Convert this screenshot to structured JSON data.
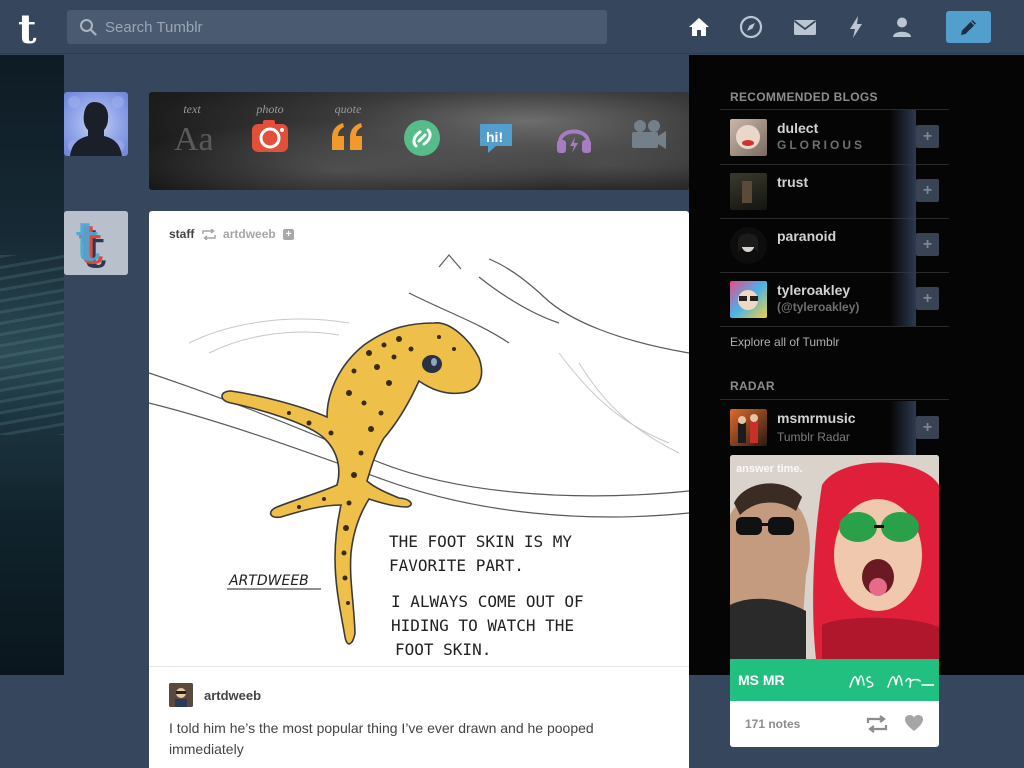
{
  "header": {
    "search_placeholder": "Search Tumblr",
    "nav_icons": [
      "home-icon",
      "explore-compass-icon",
      "inbox-envelope-icon",
      "activity-lightning-icon",
      "account-person-icon"
    ],
    "compose_icon": "pencil-icon",
    "accent": "#529ecc",
    "bg": "#36465d"
  },
  "post_types": [
    {
      "label": "text",
      "icon": "text-aa-icon"
    },
    {
      "label": "photo",
      "icon": "camera-icon",
      "color": "#e2503a"
    },
    {
      "label": "quote",
      "icon": "quote-icon",
      "color": "#f2992e"
    },
    {
      "label": "",
      "icon": "link-icon",
      "color": "#56bc8a"
    },
    {
      "label": "",
      "icon": "chat-hi-icon",
      "color": "#529ecc",
      "text": "hi!"
    },
    {
      "label": "",
      "icon": "audio-headphones-icon",
      "color": "#a77dc2"
    },
    {
      "label": "",
      "icon": "video-camera-icon",
      "color": "#748089"
    }
  ],
  "post": {
    "author": "staff",
    "reblogged_from": "artdweeb",
    "art": {
      "signature": "ARTDWEEB",
      "caption_lines": [
        "THE FOOT SKIN IS MY",
        "FAVORITE PART.",
        "I ALWAYS COME OUT OF",
        "HIDING TO WATCH THE",
        "FOOT SKIN."
      ]
    },
    "reblog_user": "artdweeb",
    "body": "I told him he’s the most popular thing I’ve ever drawn and he pooped immediately"
  },
  "sidebar": {
    "recommended_title": "RECOMMENDED BLOGS",
    "blogs": [
      {
        "name": "dulect",
        "title": "GLORIOUS"
      },
      {
        "name": "trust",
        "title": ""
      },
      {
        "name": "paranoid",
        "title": ""
      },
      {
        "name": "tyleroakley",
        "title": "(@tyleroakley)"
      }
    ],
    "explore": "Explore all of Tumblr",
    "radar_title": "RADAR",
    "radar": {
      "name": "msmrmusic",
      "subtitle": "Tumblr Radar",
      "overlay": "answer time.",
      "brand": "MS MR",
      "notes": "171 notes",
      "brand_color": "#22c080"
    }
  }
}
